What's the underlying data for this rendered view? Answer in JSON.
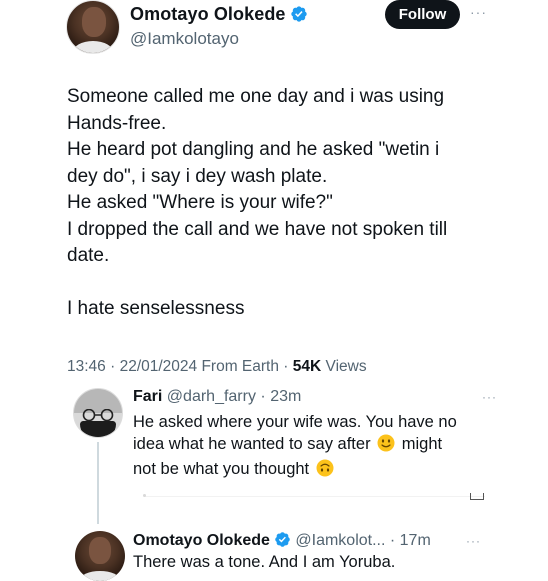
{
  "main_tweet": {
    "author": {
      "display_name": "Omotayo Olokede",
      "handle": "@Iamkolotayo",
      "verified": true
    },
    "follow_label": "Follow",
    "more_label": "···",
    "lines": [
      "Someone called me one day and i was using",
      "Hands-free.",
      "He heard pot dangling and he asked \"wetin i",
      "dey do\", i say i dey wash plate.",
      "He asked \"Where is your wife?\"",
      "I dropped the call and we have not spoken till",
      "date."
    ],
    "closing_line": "I hate senselessness",
    "meta": {
      "time": "13:46",
      "date": "22/01/2024",
      "source": "From Earth",
      "views_count": "54K",
      "views_label": "Views"
    }
  },
  "replies": [
    {
      "display_name": "Fari",
      "handle": "@darh_farry",
      "time": "23m",
      "more_label": "···",
      "lines": [
        {
          "text": "He asked where your wife was.  You have no",
          "emoji": ""
        },
        {
          "text_before": "idea what he wanted to say after",
          "emoji": "slightly-smiling-face",
          "text_after": "might"
        },
        {
          "text_before": "not be what you thought",
          "emoji": "upside-down-face"
        }
      ]
    },
    {
      "display_name": "Omotayo Olokede",
      "handle": "@Iamkolot...",
      "time": "17m",
      "verified": true,
      "more_label": "···",
      "text": "There was a tone. And I am Yoruba."
    }
  ],
  "colors": {
    "text": "#0f1419",
    "secondary": "#536471",
    "verified_blue": "#1d9bf0",
    "follow_bg": "#0f1419",
    "thread_line": "#cfd9de"
  }
}
